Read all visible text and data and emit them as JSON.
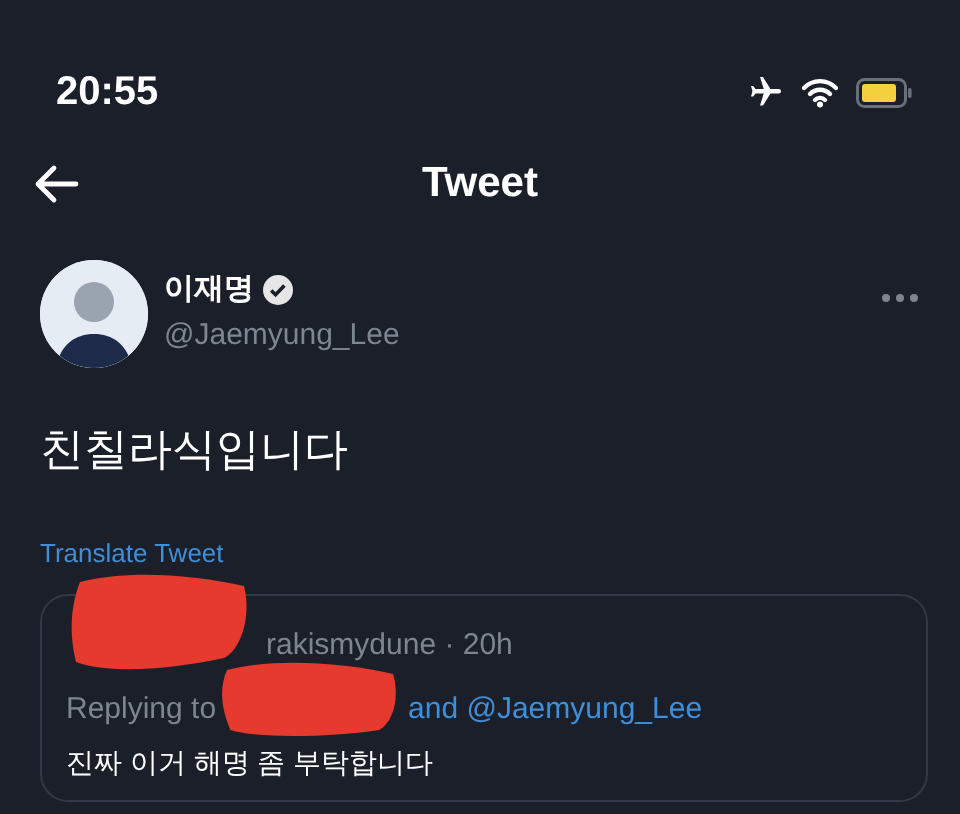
{
  "status_bar": {
    "time": "20:55"
  },
  "header": {
    "title": "Tweet"
  },
  "tweet": {
    "author_name": "이재명",
    "verified": true,
    "handle": "@Jaemyung_Lee",
    "text": "친칠라식입니다",
    "translate_link": "Translate Tweet"
  },
  "quoted_reply": {
    "meta": "rakismydune · 20h",
    "replying_to_label": "Replying to",
    "replying_to_handles": "and @Jaemyung_Lee",
    "text": "진짜 이거 해명 좀 부탁합니다"
  }
}
